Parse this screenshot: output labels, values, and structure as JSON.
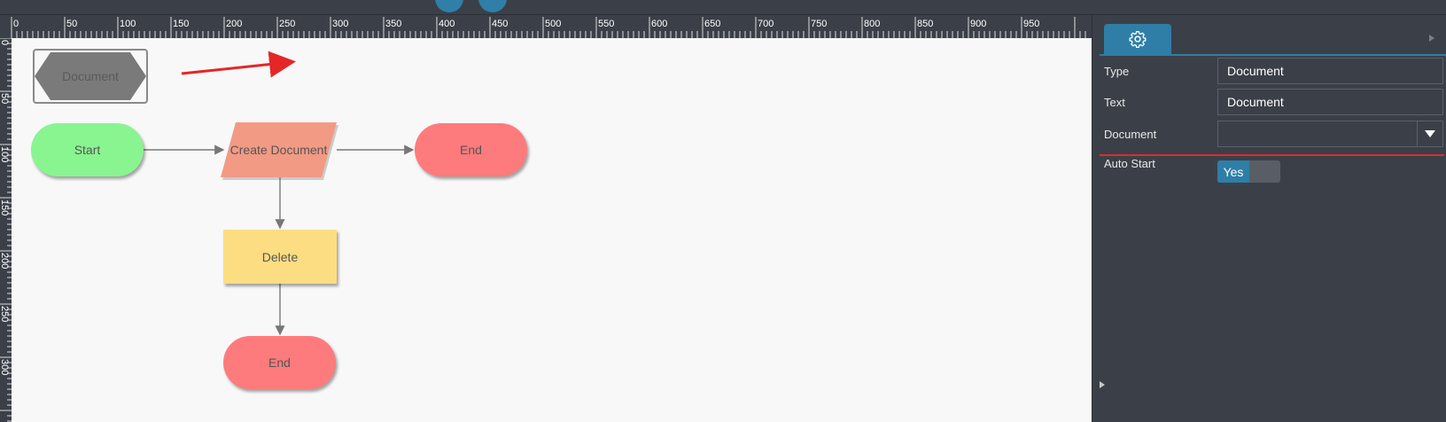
{
  "ruler": {
    "h_labels": [
      "0",
      "50",
      "100",
      "150",
      "200",
      "250",
      "300",
      "350",
      "400",
      "450",
      "500",
      "550",
      "600",
      "650",
      "700",
      "750",
      "800",
      "850",
      "900",
      "950"
    ],
    "v_labels": [
      "0",
      "50",
      "100",
      "150",
      "200",
      "250",
      "300"
    ]
  },
  "canvas": {
    "selected_shape_label": "Document",
    "nodes": {
      "start": "Start",
      "create_document": "Create Document",
      "end_right": "End",
      "delete": "Delete",
      "end_bottom": "End"
    },
    "colors": {
      "start": "#88f590",
      "create_document": "#f29a84",
      "end": "#fe7b7d",
      "delete": "#fddd82",
      "annotation_arrow": "#e42626"
    }
  },
  "panel": {
    "tab_icon": "gear-icon",
    "properties": {
      "type_label": "Type",
      "type_value": "Document",
      "text_label": "Text",
      "text_value": "Document",
      "document_label": "Document",
      "document_value": "",
      "auto_start_label": "Auto Start",
      "auto_start_value": "Yes"
    }
  }
}
